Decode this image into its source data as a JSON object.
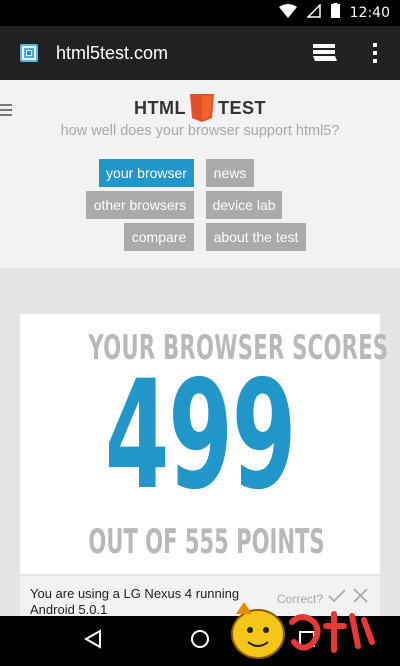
{
  "status_bar": {
    "time": "12:40",
    "icons": [
      "wifi-icon",
      "no-signal-icon",
      "battery-icon"
    ]
  },
  "toolbar": {
    "url": "html5test.com",
    "icons": [
      "site-favicon-icon",
      "tabs-icon",
      "overflow-menu-icon"
    ]
  },
  "header": {
    "logo_left": "HTML",
    "logo_number": "5",
    "logo_right": "TEST",
    "tagline": "how well does your browser support html5?"
  },
  "nav": [
    {
      "label": "your browser",
      "active": true
    },
    {
      "label": "news",
      "active": false
    },
    {
      "label": "other browsers",
      "active": false
    },
    {
      "label": "device lab",
      "active": false
    },
    {
      "label": "compare",
      "active": false
    },
    {
      "label": "about the test",
      "active": false
    }
  ],
  "score": {
    "heading": "YOUR BROWSER SCORES",
    "value": "499",
    "footer": "OUT OF 555 POINTS"
  },
  "device": {
    "text": "You are using a LG Nexus 4 running Android 5.0.1",
    "correct_label": "Correct?"
  },
  "colors": {
    "accent": "#2196c8",
    "button_gray": "#aaaaaa",
    "logo_orange": "#e34f26",
    "toolbar": "#212121"
  }
}
